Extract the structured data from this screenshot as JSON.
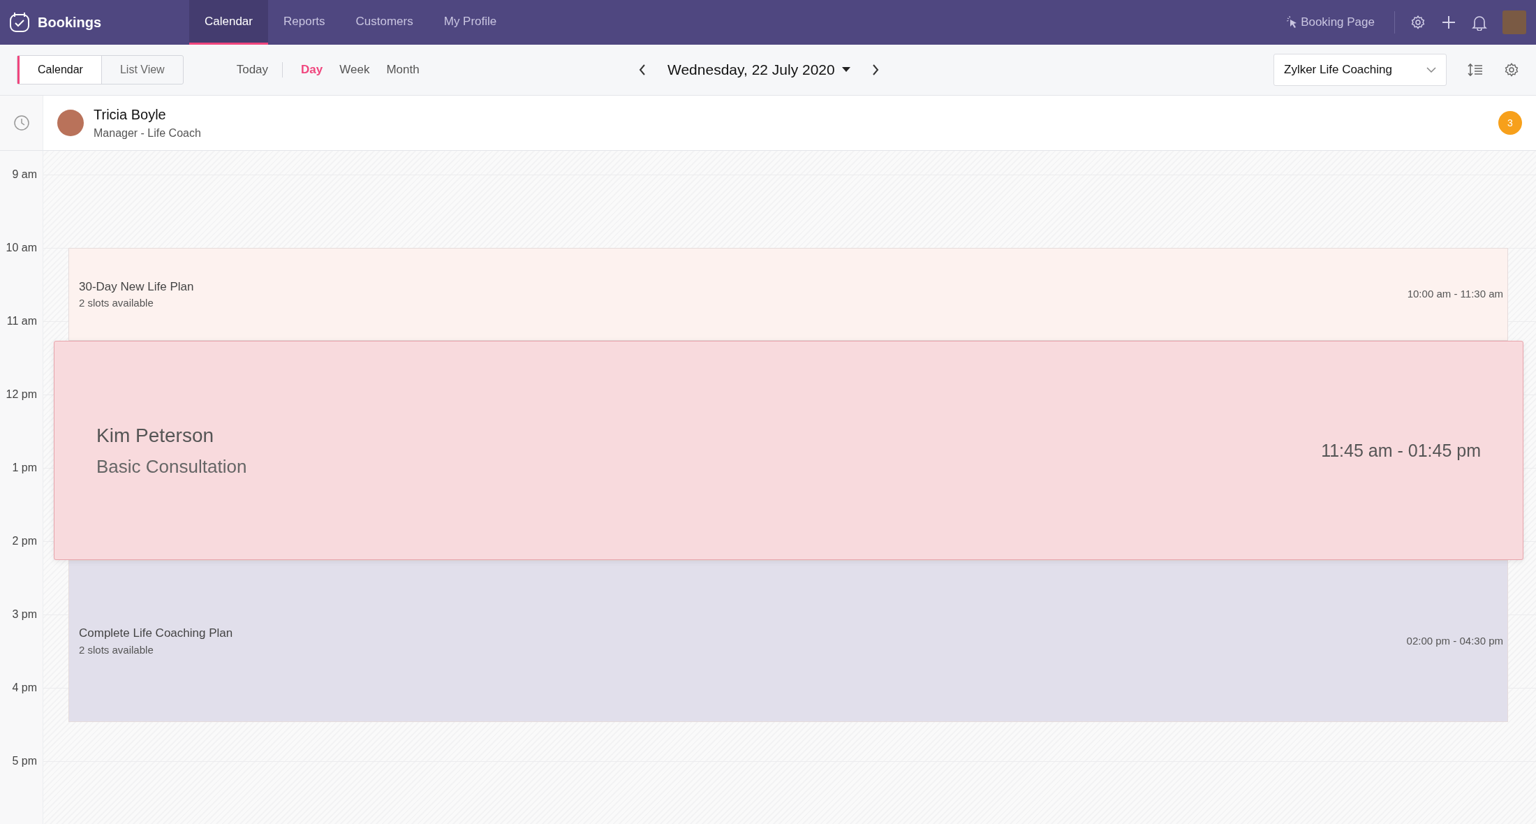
{
  "app": {
    "name": "Bookings"
  },
  "nav_tabs": [
    {
      "label": "Calendar",
      "selected": true
    },
    {
      "label": "Reports",
      "selected": false
    },
    {
      "label": "Customers",
      "selected": false
    },
    {
      "label": "My Profile",
      "selected": false
    }
  ],
  "header_actions": {
    "booking_page": "Booking Page"
  },
  "view_switch": [
    {
      "label": "Calendar",
      "selected": true
    },
    {
      "label": "List View",
      "selected": false
    }
  ],
  "today": "Today",
  "ranges": [
    {
      "label": "Day",
      "selected": true
    },
    {
      "label": "Week",
      "selected": false
    },
    {
      "label": "Month",
      "selected": false
    }
  ],
  "date": "Wednesday, 22 July 2020",
  "workspace": "Zylker Life Coaching",
  "staff": {
    "name": "Tricia Boyle",
    "role": "Manager - Life Coach",
    "count": "3"
  },
  "hours": [
    "9 am",
    "10 am",
    "11 am",
    "12 pm",
    "1 pm",
    "2 pm",
    "3 pm",
    "4 pm",
    "5 pm"
  ],
  "events": [
    {
      "kind": "slot",
      "title": "30-Day New Life Plan",
      "subtitle": "2 slots available",
      "time": "10:00 am - 11:30 am",
      "color": "#fdf2ef"
    },
    {
      "kind": "booking",
      "title": "Kim Peterson",
      "subtitle": "Basic Consultation",
      "time": "11:45 am - 01:45 pm",
      "color": "#f8dadd"
    },
    {
      "kind": "slot",
      "title": "Complete Life Coaching Plan",
      "subtitle": "2 slots available",
      "time": "02:00 pm - 04:30 pm",
      "color": "#e1dfeb"
    }
  ]
}
